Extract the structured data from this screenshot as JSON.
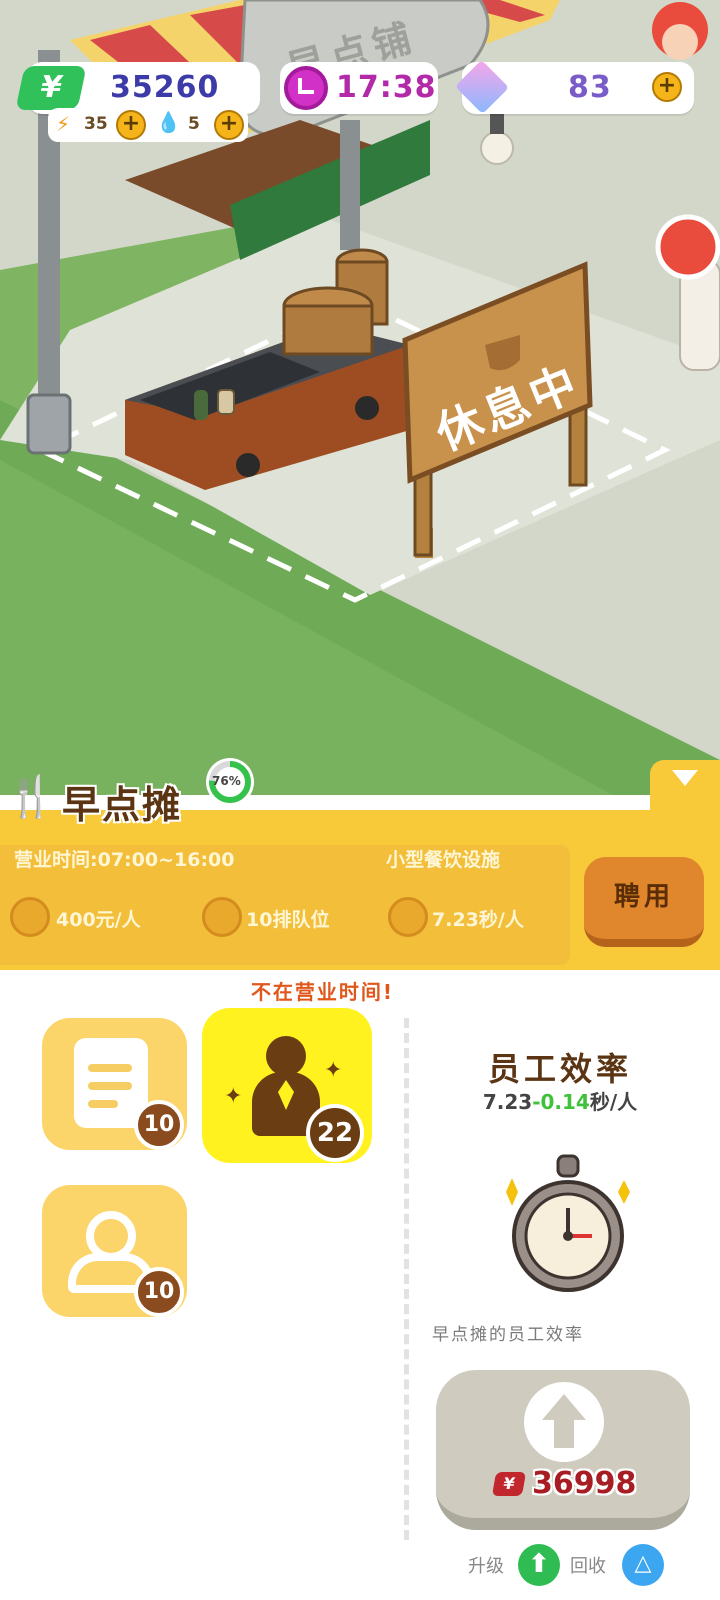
{
  "hud": {
    "money": "35260",
    "energy": "35",
    "water": "5",
    "time": "17:38",
    "gems": "83",
    "plus": "+"
  },
  "scene": {
    "shop_sign": "早点铺",
    "rest_sign": "休息中"
  },
  "facility": {
    "name": "早点摊",
    "progress_percent": 76,
    "progress_label": "76%",
    "hours": "营业时间:07:00~16:00",
    "category": "小型餐饮设施",
    "price": "400元/人",
    "queue": "10排队位",
    "speed": "7.23秒/人",
    "hire_button": "聘用",
    "closed_notice": "不在营业时间!"
  },
  "tiles": [
    {
      "name": "menu",
      "badge": "10"
    },
    {
      "name": "staff",
      "badge": "22"
    },
    {
      "name": "customers",
      "badge": "10"
    }
  ],
  "efficiency": {
    "title": "员工效率",
    "base": "7.23",
    "bonus": "-0.14",
    "unit": "秒/人",
    "caption": "早点摊的员工效率"
  },
  "upgrade": {
    "cost": "36998",
    "upgrade_label": "升级",
    "recycle_label": "回收"
  },
  "colors": {
    "accent_yellow": "#f8ca3a",
    "hire_orange": "#e0862c",
    "bonus_green": "#3fc23a",
    "hud_text": "#3d3ba8"
  }
}
